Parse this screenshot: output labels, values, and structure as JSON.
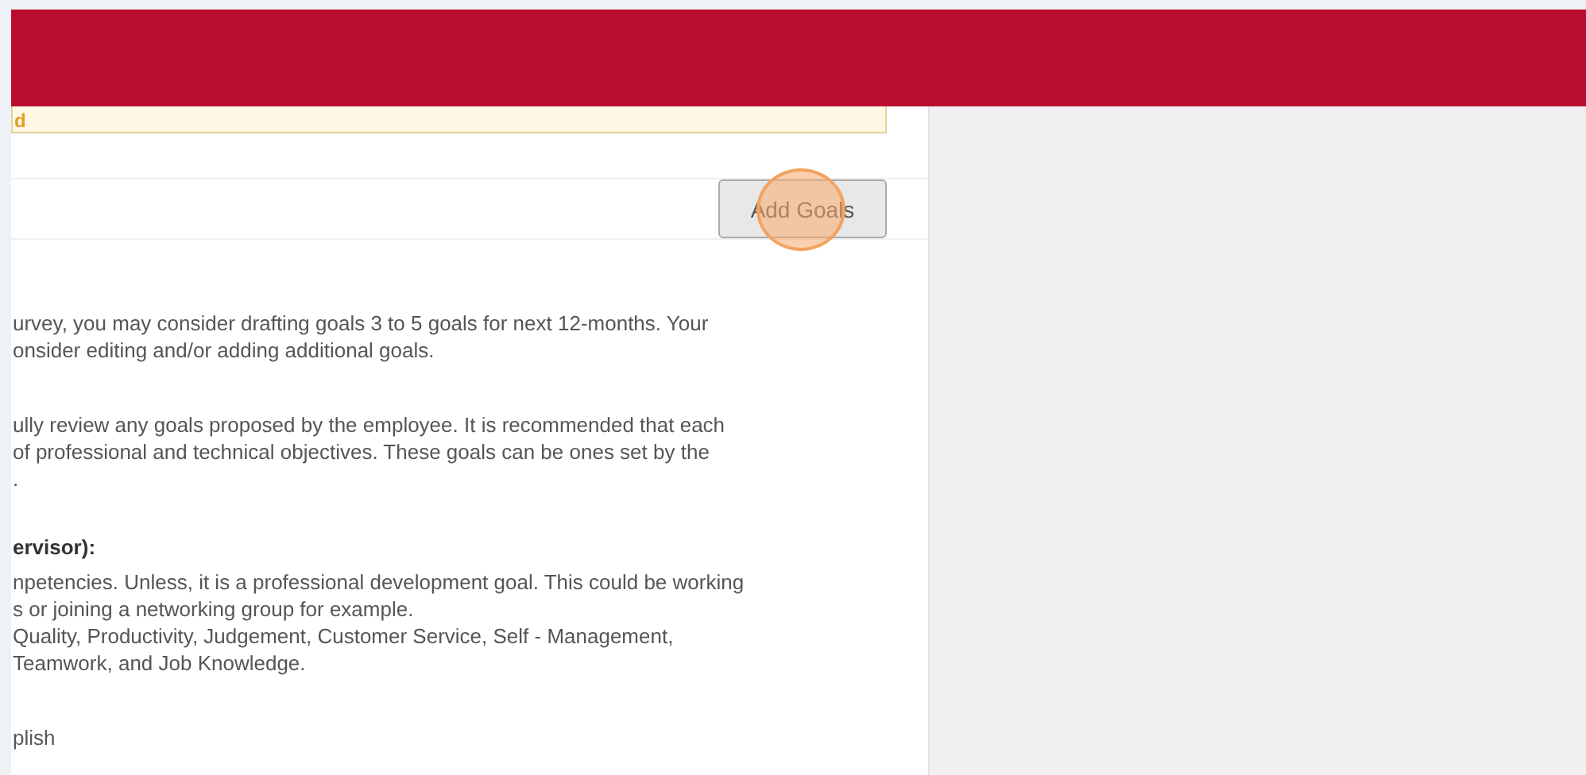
{
  "alert": {
    "text": "d"
  },
  "toolbar": {
    "button": "Add Goals",
    "click_highlight": true
  },
  "blocks": [
    {
      "kind": "text",
      "lines": [
        "urvey, you may consider drafting goals 3 to 5 goals for next 12-months. Your",
        "onsider editing and/or adding additional goals."
      ]
    },
    {
      "kind": "text",
      "lines": [
        "ully review any goals proposed by the employee. It is recommended that each",
        "of professional and technical objectives. These goals can be ones set by the",
        "."
      ]
    },
    {
      "kind": "heading",
      "lines": [
        "ervisor):"
      ]
    },
    {
      "kind": "text",
      "lines": [
        "npetencies. Unless, it is a professional development goal. This could be working",
        "s or joining a networking group for example.",
        "Quality, Productivity, Judgement, Customer Service, Self - Management,",
        "Teamwork, and Job Knowledge."
      ]
    },
    {
      "kind": "text",
      "lines": [
        "plish"
      ]
    }
  ]
}
